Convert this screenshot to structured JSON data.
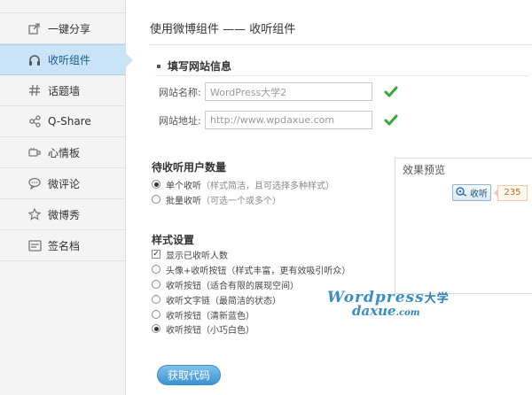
{
  "sidebar": {
    "items": [
      {
        "label": "一键分享",
        "icon": "share-icon",
        "active": false
      },
      {
        "label": "收听组件",
        "icon": "headphones-icon",
        "active": true
      },
      {
        "label": "话题墙",
        "icon": "hashtag-icon",
        "active": false
      },
      {
        "label": "Q-Share",
        "icon": "qshare-icon",
        "active": false
      },
      {
        "label": "心情板",
        "icon": "mood-board-icon",
        "active": false
      },
      {
        "label": "微评论",
        "icon": "comment-icon",
        "active": false
      },
      {
        "label": "微博秀",
        "icon": "star-show-icon",
        "active": false
      },
      {
        "label": "签名档",
        "icon": "signature-card-icon",
        "active": false
      }
    ]
  },
  "main": {
    "title": "使用微博组件 —— 收听组件",
    "site_section": {
      "heading": "填写网站信息",
      "name_label": "网站名称:",
      "name_value": "WordPress大学2",
      "url_label": "网站地址:",
      "url_value": "http://www.wpdaxue.com"
    },
    "listen_count": {
      "heading": "待收听用户数量",
      "options": [
        {
          "label": "单个收听",
          "note": "（样式简洁，且可选择多种样式）",
          "selected": true
        },
        {
          "label": "批量收听",
          "note": "（可选一个或多个）",
          "selected": false
        }
      ]
    },
    "style_settings": {
      "heading": "样式设置",
      "show_count_label": "显示已收听人数",
      "show_count_checked": true,
      "options": [
        {
          "label": "头像+收听按钮",
          "note": "（样式丰富，更有效吸引听众）",
          "selected": false
        },
        {
          "label": "收听按钮",
          "note": "（适合有限的展现空间）",
          "selected": false
        },
        {
          "label": "收听文字链",
          "note": "（最简洁的状态）",
          "selected": false
        },
        {
          "label": "收听按钮",
          "note": "（清新蓝色）",
          "selected": false
        },
        {
          "label": "收听按钮",
          "note": "（小巧白色）",
          "selected": true
        }
      ]
    },
    "preview": {
      "title": "效果预览",
      "button_label": "收听",
      "count": "235"
    },
    "watermark": {
      "line1": "Wordpress",
      "line1_cn": "大学",
      "line2": "daxue",
      "line2_domain": ".com"
    },
    "get_code_label": "获取代码"
  },
  "colors": {
    "accent": "#3b93d3",
    "sidebar_active": "#c9e4f8",
    "check_green": "#3aa632",
    "count_orange": "#d3671a"
  }
}
